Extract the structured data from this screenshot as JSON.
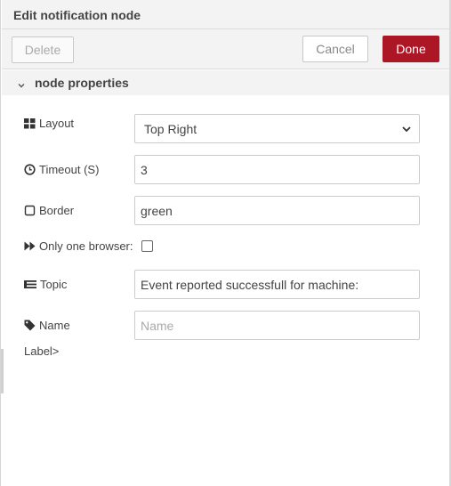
{
  "tray": {
    "title": "Edit notification node"
  },
  "toolbar": {
    "delete_label": "Delete",
    "cancel_label": "Cancel",
    "done_label": "Done"
  },
  "section": {
    "label": "node properties"
  },
  "fields": {
    "layout": {
      "label": "Layout",
      "value": "Top Right"
    },
    "timeout": {
      "label": "Timeout (S)",
      "value": "3"
    },
    "border": {
      "label": "Border",
      "value": "green"
    },
    "only_one": {
      "label": "Only one browser:",
      "checked": false
    },
    "topic": {
      "label": "Topic",
      "value": "Event reported successfull for machine:"
    },
    "name": {
      "label": "Name",
      "value": "",
      "placeholder": "Name"
    }
  },
  "footer_text": "Label>",
  "colors": {
    "primary": "#ad1625",
    "panel": "#f3f3f3",
    "border": "#cccccc"
  }
}
